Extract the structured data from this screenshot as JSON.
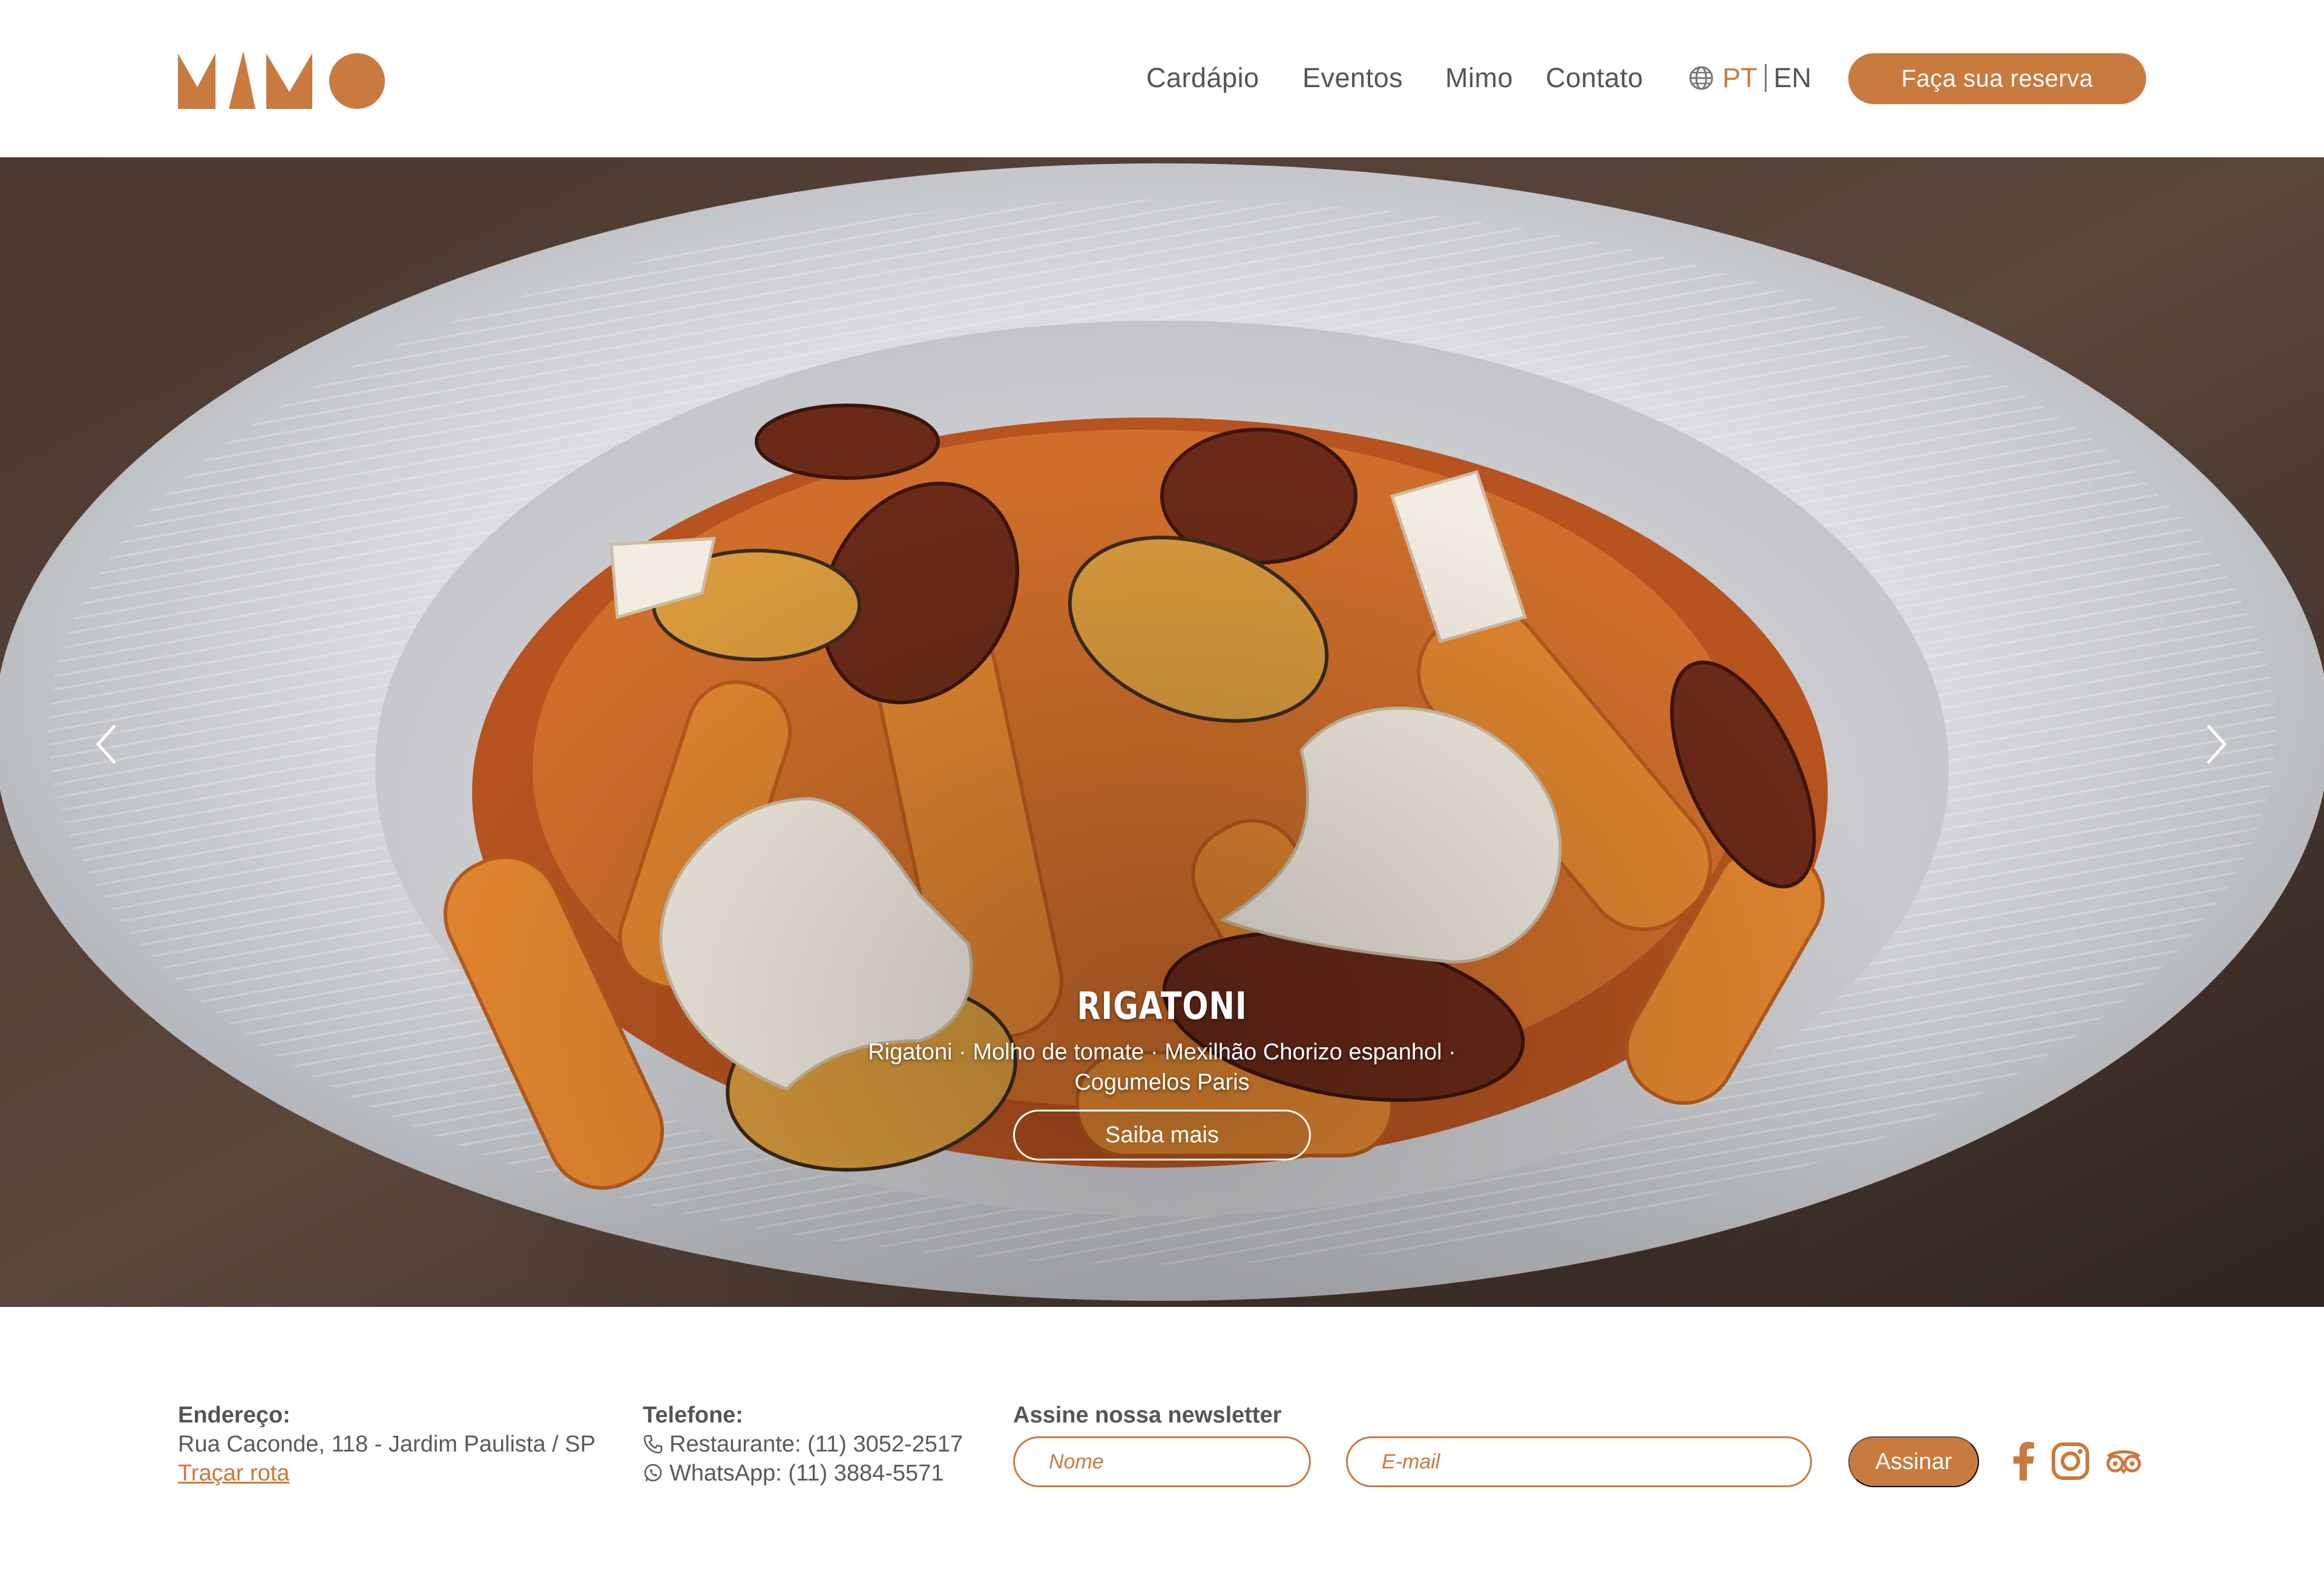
{
  "header": {
    "logo_text": "MIMO",
    "nav": [
      {
        "label": "Cardápio"
      },
      {
        "label": "Eventos"
      },
      {
        "label": "Mimo"
      },
      {
        "label": "Contato"
      }
    ],
    "language": {
      "pt": "PT",
      "en": "EN",
      "active": "PT"
    },
    "reserve_label": "Faça sua reserva"
  },
  "hero": {
    "title": "RIGATONI",
    "description_line1": "Rigatoni · Molho de tomate · Mexilhão Chorizo espanhol ·",
    "description_line2": "Cogumelos Paris",
    "cta_label": "Saiba mais",
    "slide_count": 5,
    "active_slide": 4
  },
  "footer": {
    "address": {
      "label": "Endereço:",
      "value": "Rua Caconde, 118 - Jardim Paulista / SP",
      "route_link": "Traçar rota"
    },
    "phone": {
      "label": "Telefone:",
      "restaurant": "Restaurante: (11) 3052-2517",
      "whatsapp": "WhatsApp:  (11) 3884-5571"
    },
    "newsletter": {
      "label": "Assine nossa newsletter",
      "name_placeholder": "Nome",
      "email_placeholder": "E-mail",
      "submit_label": "Assinar"
    },
    "social_icons": [
      "facebook-icon",
      "instagram-icon",
      "tripadvisor-icon"
    ]
  },
  "colors": {
    "accent": "#c97a3f",
    "text": "#555555",
    "background": "#ffffff"
  }
}
